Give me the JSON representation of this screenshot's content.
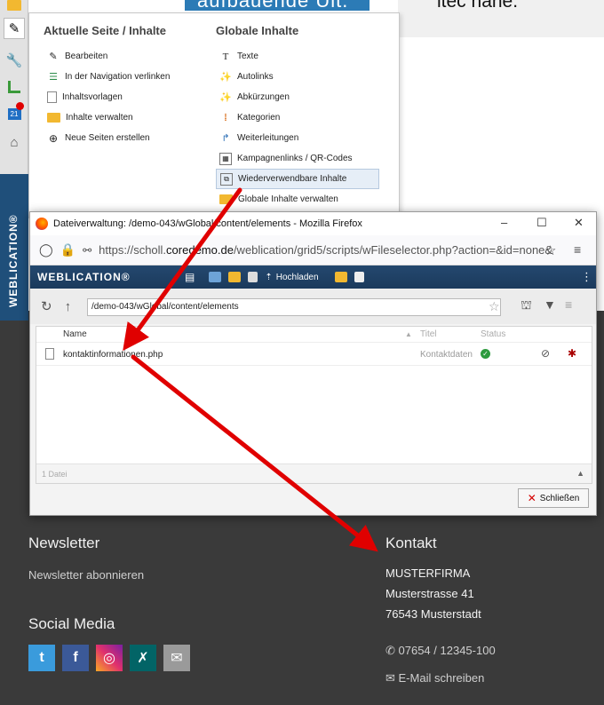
{
  "hero": {
    "text": "ltec nane.",
    "banner": "aufbauende Ult."
  },
  "menu": {
    "col1": {
      "title": "Aktuelle Seite / Inhalte",
      "items": [
        "Bearbeiten",
        "In der Navigation verlinken",
        "Inhaltsvorlagen",
        "Inhalte verwalten",
        "Neue Seiten erstellen"
      ]
    },
    "col2": {
      "title": "Globale Inhalte",
      "items": [
        "Texte",
        "Autolinks",
        "Abkürzungen",
        "Kategorien",
        "Weiterleitungen",
        "Kampagnenlinks / QR-Codes",
        "Wiederverwendbare Inhalte",
        "Globale Inhalte verwalten"
      ]
    }
  },
  "cms": {
    "brand": "WEBLICATION®",
    "calendar_day": "21"
  },
  "dialog": {
    "title": "Dateiverwaltung: /demo-043/wGlobal/content/elements - Mozilla Firefox",
    "url_prefix": "https://scholl.",
    "url_domain": "coredemo.de",
    "url_suffix": "/weblication/grid5/scripts/wFileselector.php?action=&id=none&",
    "app_logo": "WEBLICATION®",
    "upload_label": "Hochladen",
    "path": "/demo-043/wGlobal/content/elements",
    "columns": {
      "name": "Name",
      "title": "Titel",
      "status": "Status"
    },
    "files": [
      {
        "name": "kontaktinformationen.php",
        "title": "Kontaktdaten"
      }
    ],
    "count": "1 Datei",
    "close_label": "Schließen"
  },
  "footer": {
    "newsletter_heading": "Newsletter",
    "newsletter_link": "Newsletter abonnieren",
    "social_heading": "Social Media",
    "contact_heading": "Kontakt",
    "company": "MUSTERFIRMA",
    "street": "Musterstrasse 41",
    "city": "76543 Musterstadt",
    "phone": "07654 / 12345-100",
    "email_link": "E-Mail schreiben"
  },
  "colors": {
    "accent_blue": "#2c7bb6",
    "arrow_red": "#e00000",
    "brand_dark": "#1f4f7a",
    "footer_bg": "#3a3a3a"
  }
}
